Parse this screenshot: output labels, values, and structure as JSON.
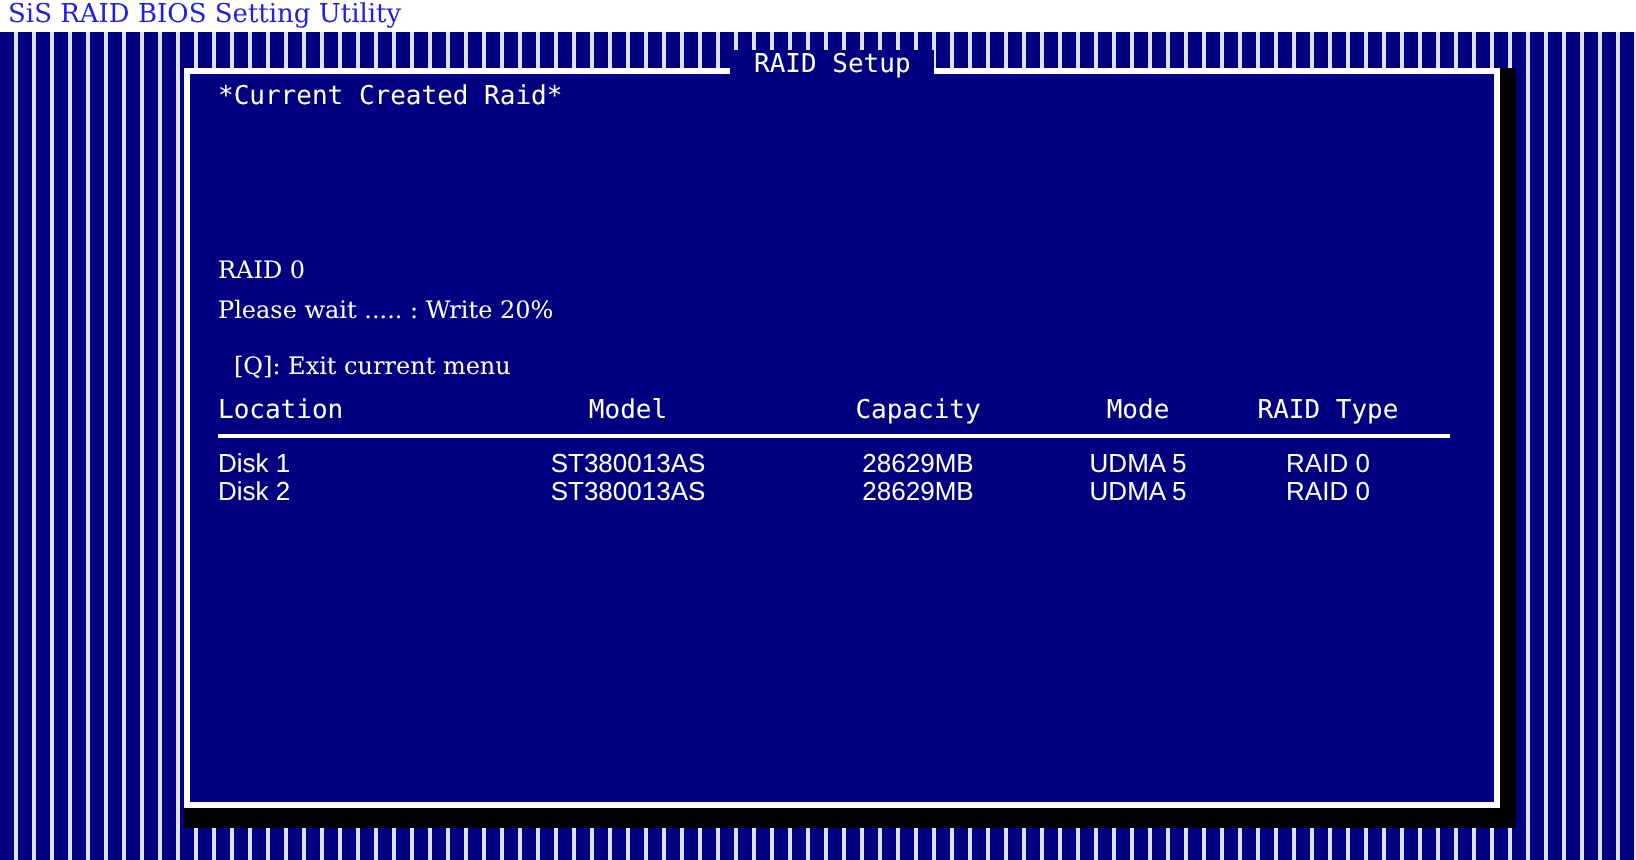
{
  "page_title": "SiS RAID BIOS Setting Utility",
  "dialog": {
    "title": "RAID Setup",
    "subtitle": "*Current Created Raid*",
    "raid_name": "RAID 0",
    "status": "Please wait ..... :  Write  20%",
    "hint": "[Q]: Exit current menu"
  },
  "table": {
    "columns": [
      "Location",
      "Model",
      "Capacity",
      "Mode",
      "RAID Type"
    ],
    "rows": [
      {
        "cells": [
          "Disk 1",
          "ST380013AS",
          "28629MB",
          "UDMA 5",
          "RAID 0"
        ]
      },
      {
        "cells": [
          "Disk 2",
          "ST380013AS",
          "28629MB",
          "UDMA 5",
          "RAID 0"
        ]
      }
    ]
  }
}
